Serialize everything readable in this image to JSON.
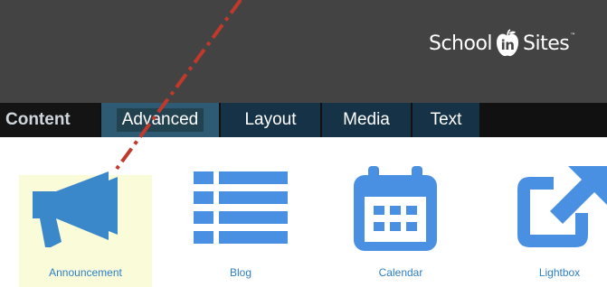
{
  "header": {
    "logo": {
      "pre": "School",
      "mid": "in",
      "post": "Sites",
      "tm": "™"
    }
  },
  "tabs": [
    {
      "key": "content",
      "label": "Content"
    },
    {
      "key": "advanced",
      "label": "Advanced",
      "active": true
    },
    {
      "key": "layout",
      "label": "Layout"
    },
    {
      "key": "media",
      "label": "Media"
    },
    {
      "key": "text",
      "label": "Text"
    }
  ],
  "tiles": [
    {
      "key": "announcement",
      "label": "Announcement",
      "icon": "megaphone-icon",
      "selected": true
    },
    {
      "key": "blog",
      "label": "Blog",
      "icon": "list-icon"
    },
    {
      "key": "calendar",
      "label": "Calendar",
      "icon": "calendar-icon"
    },
    {
      "key": "lightbox",
      "label": "Lightbox",
      "icon": "external-link-icon"
    }
  ],
  "colors": {
    "header_bg": "#434343",
    "tab_bg": "#163246",
    "tab_active": "#2f5a73",
    "icon_blue": "#4a90e2",
    "icon_blue_dark": "#3a87c9",
    "label_blue": "#2d7fc4",
    "selected_bg": "#f9fbd9",
    "annotation_red": "#c0392b"
  }
}
